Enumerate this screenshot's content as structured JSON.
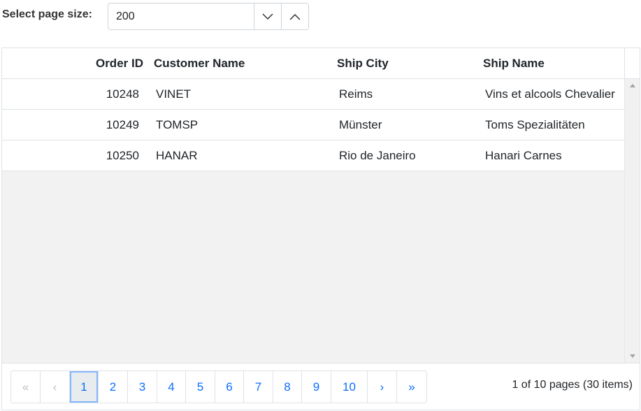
{
  "toolbar": {
    "page_size_label": "Select page size:",
    "page_size_value": "200"
  },
  "grid": {
    "columns": [
      "Order ID",
      "Customer Name",
      "Ship City",
      "Ship Name"
    ],
    "rows": [
      [
        "10248",
        "VINET",
        "Reims",
        "Vins et alcools Chevalier"
      ],
      [
        "10249",
        "TOMSP",
        "Münster",
        "Toms Spezialitäten"
      ],
      [
        "10250",
        "HANAR",
        "Rio de Janeiro",
        "Hanari Carnes"
      ]
    ]
  },
  "pager": {
    "first": "«",
    "prev": "‹",
    "pages": [
      "1",
      "2",
      "3",
      "4",
      "5",
      "6",
      "7",
      "8",
      "9",
      "10"
    ],
    "next": "›",
    "last": "»",
    "current_page": "1",
    "info": "1 of 10 pages (30 items)"
  },
  "icons": {
    "spin_down": "chevron-down-icon",
    "spin_up": "chevron-up-icon",
    "scroll_up": "scroll-up-arrow-icon",
    "scroll_down": "scroll-down-arrow-icon"
  },
  "colors": {
    "link": "#0d6efd",
    "active_page_bg": "#e9ecef",
    "active_page_ring": "#86b7fe",
    "border": "#dee2e6",
    "empty_area": "#f2f2f2"
  }
}
